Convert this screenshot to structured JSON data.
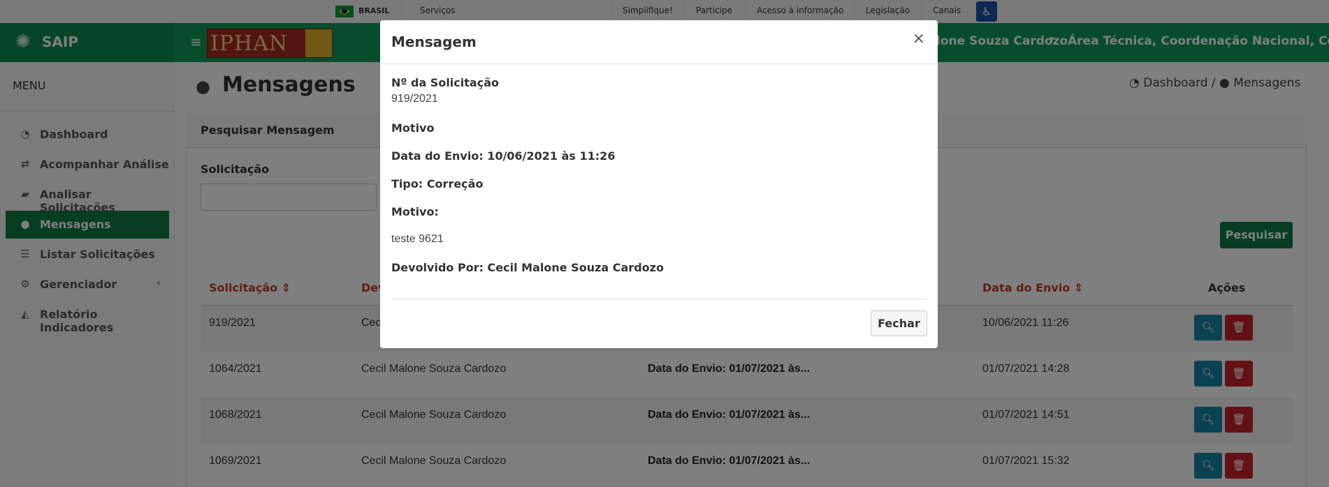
{
  "govbar": {
    "brasil": "BRASIL",
    "servicos": "Serviços",
    "links": [
      "Simplifique!",
      "Participe",
      "Acesso à informação",
      "Legislação",
      "Canais"
    ]
  },
  "header": {
    "brand": "SAIP",
    "logo_text": "IPHAN",
    "user": "lone Souza Cardozo",
    "area": "Área Técnica, Coordenação Nacional, Coor..."
  },
  "sidebar": {
    "title": "MENU",
    "items": [
      {
        "label": "Dashboard",
        "icon": "dashboard-icon"
      },
      {
        "label": "Acompanhar Análise",
        "icon": "exchange-icon"
      },
      {
        "label": "Analisar Solicitações",
        "icon": "book-icon"
      },
      {
        "label": "Mensagens",
        "icon": "comments-icon",
        "active": true
      },
      {
        "label": "Listar Solicitações",
        "icon": "list-icon"
      },
      {
        "label": "Gerenciador",
        "icon": "cogs-icon"
      },
      {
        "label": "Relatório Indicadores",
        "icon": "area-chart-icon"
      }
    ]
  },
  "page": {
    "title": "Mensagens",
    "breadcrumb": [
      "Dashboard",
      "Mensagens"
    ],
    "card_title": "Pesquisar Mensagem",
    "search_label": "Solicitação",
    "search_value": "",
    "search_button": "Pesquisar"
  },
  "table": {
    "headers": [
      "Solicitação",
      "Dev",
      "Data do Envio",
      "Ações"
    ],
    "rows": [
      {
        "solicitacao": "919/2021",
        "devolvido": "Cec",
        "motivo": "",
        "data": "10/06/2021 11:26"
      },
      {
        "solicitacao": "1064/2021",
        "devolvido": "Cecil Malone Souza Cardozo",
        "motivo": "Data do Envio: 01/07/2021 às...",
        "data": "01/07/2021 14:28"
      },
      {
        "solicitacao": "1068/2021",
        "devolvido": "Cecil Malone Souza Cardozo",
        "motivo": "Data do Envio: 01/07/2021 às...",
        "data": "01/07/2021 14:51"
      },
      {
        "solicitacao": "1069/2021",
        "devolvido": "Cecil Malone Souza Cardozo",
        "motivo": "Data do Envio: 01/07/2021 às...",
        "data": "01/07/2021 15:32"
      }
    ]
  },
  "modal": {
    "title": "Mensagem",
    "close": "×",
    "solicitacao_label": "Nº da Solicitação",
    "solicitacao_value": "919/2021",
    "motivo_label": "Motivo",
    "data_envio": "Data do Envio: 10/06/2021 às 11:26",
    "tipo": "Tipo: Correção",
    "motivo2_label": "Motivo:",
    "motivo_text": "teste 9621",
    "devolvido": "Devolvido Por: Cecil Malone Souza Cardozo",
    "fechar": "Fechar"
  },
  "colors": {
    "header": "#0f9a5a",
    "sidebar_active": "#0f7a47",
    "link": "#c0392b",
    "view_button": "#1784a4",
    "delete_button": "#c8232c"
  }
}
